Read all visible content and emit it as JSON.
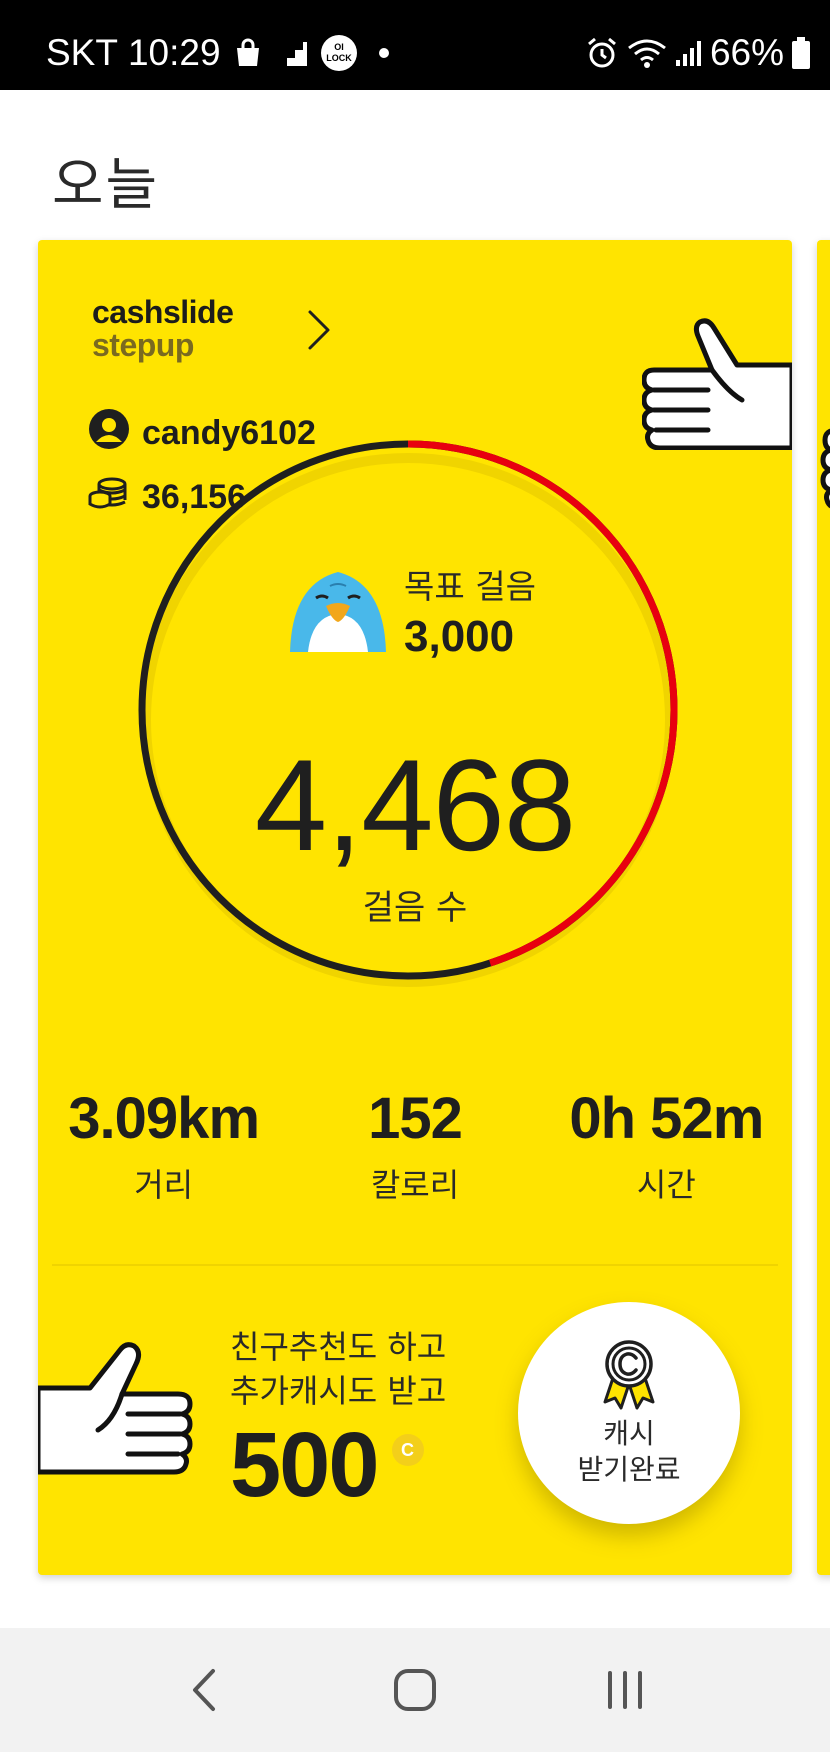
{
  "status_bar": {
    "carrier": "SKT",
    "time": "10:29",
    "lock_badge_text": "OI LOCK",
    "battery": "66%"
  },
  "page": {
    "title": "오늘"
  },
  "card": {
    "brand_line1": "cashslide",
    "brand_line2": "stepup",
    "username": "candy6102",
    "coins": "36,156",
    "goal_label": "목표 걸음",
    "goal_value": "3,000",
    "steps_value": "4,468",
    "steps_label": "걸음 수",
    "goal_progress_fraction": 0.45,
    "stats": [
      {
        "value": "3.09km",
        "label": "거리"
      },
      {
        "value": "152",
        "label": "칼로리"
      },
      {
        "value": "0h 52m",
        "label": "시간"
      }
    ],
    "promo_line1": "친구추천도 하고",
    "promo_line2": "추가캐시도 받고",
    "promo_amount": "500",
    "promo_currency_symbol": "C",
    "cash_button_line1": "캐시",
    "cash_button_line2": "받기완료"
  },
  "colors": {
    "card_bg": "#ffe400",
    "ring_dark": "#1f1f1f",
    "ring_progress": "#e8000f",
    "status_bar_bg": "#000000"
  },
  "icons": {
    "user": "user-circle-icon",
    "coins": "coin-stack-icon",
    "chevron": "chevron-right-icon",
    "thumb": "thumbs-up-icon",
    "penguin": "penguin-mascot-icon",
    "medal": "medal-icon"
  }
}
